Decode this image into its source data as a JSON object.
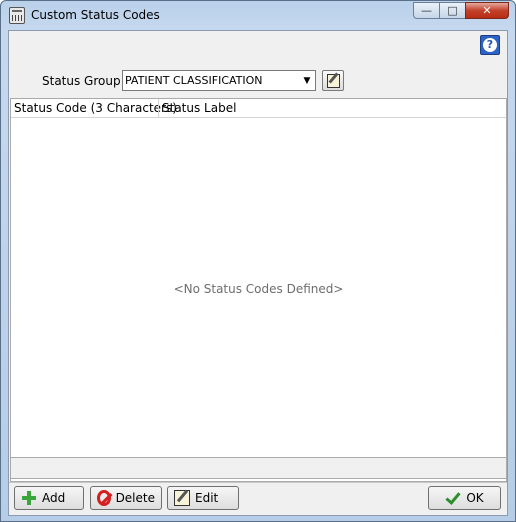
{
  "window": {
    "title": "Custom Status Codes",
    "caption_buttons": {
      "minimize": "—",
      "maximize": "□",
      "close": "✕"
    }
  },
  "help": {
    "label": "?"
  },
  "status_group": {
    "label": "Status Group:",
    "value": "PATIENT CLASSIFICATION",
    "dropdown_arrow": "▼"
  },
  "table": {
    "columns": [
      "Status Code (3 Characters)",
      "Status Label"
    ],
    "rows": [],
    "empty_message": "<No Status Codes Defined>"
  },
  "buttons": {
    "add": "Add",
    "delete": "Delete",
    "edit": "Edit",
    "ok": "OK"
  },
  "icons": {
    "app": "app-calendar-icon",
    "help": "help-icon",
    "edit_group": "edit-icon",
    "add": "plus-icon",
    "delete": "no-sign-icon",
    "edit": "edit-icon",
    "ok": "checkmark-icon"
  },
  "colors": {
    "titlebar": "#c6d8ee",
    "client": "#f0f0f0",
    "help_blue": "#2d62c6",
    "close_red": "#c4402a",
    "add_green": "#3aa53a",
    "delete_red": "#d42020"
  }
}
